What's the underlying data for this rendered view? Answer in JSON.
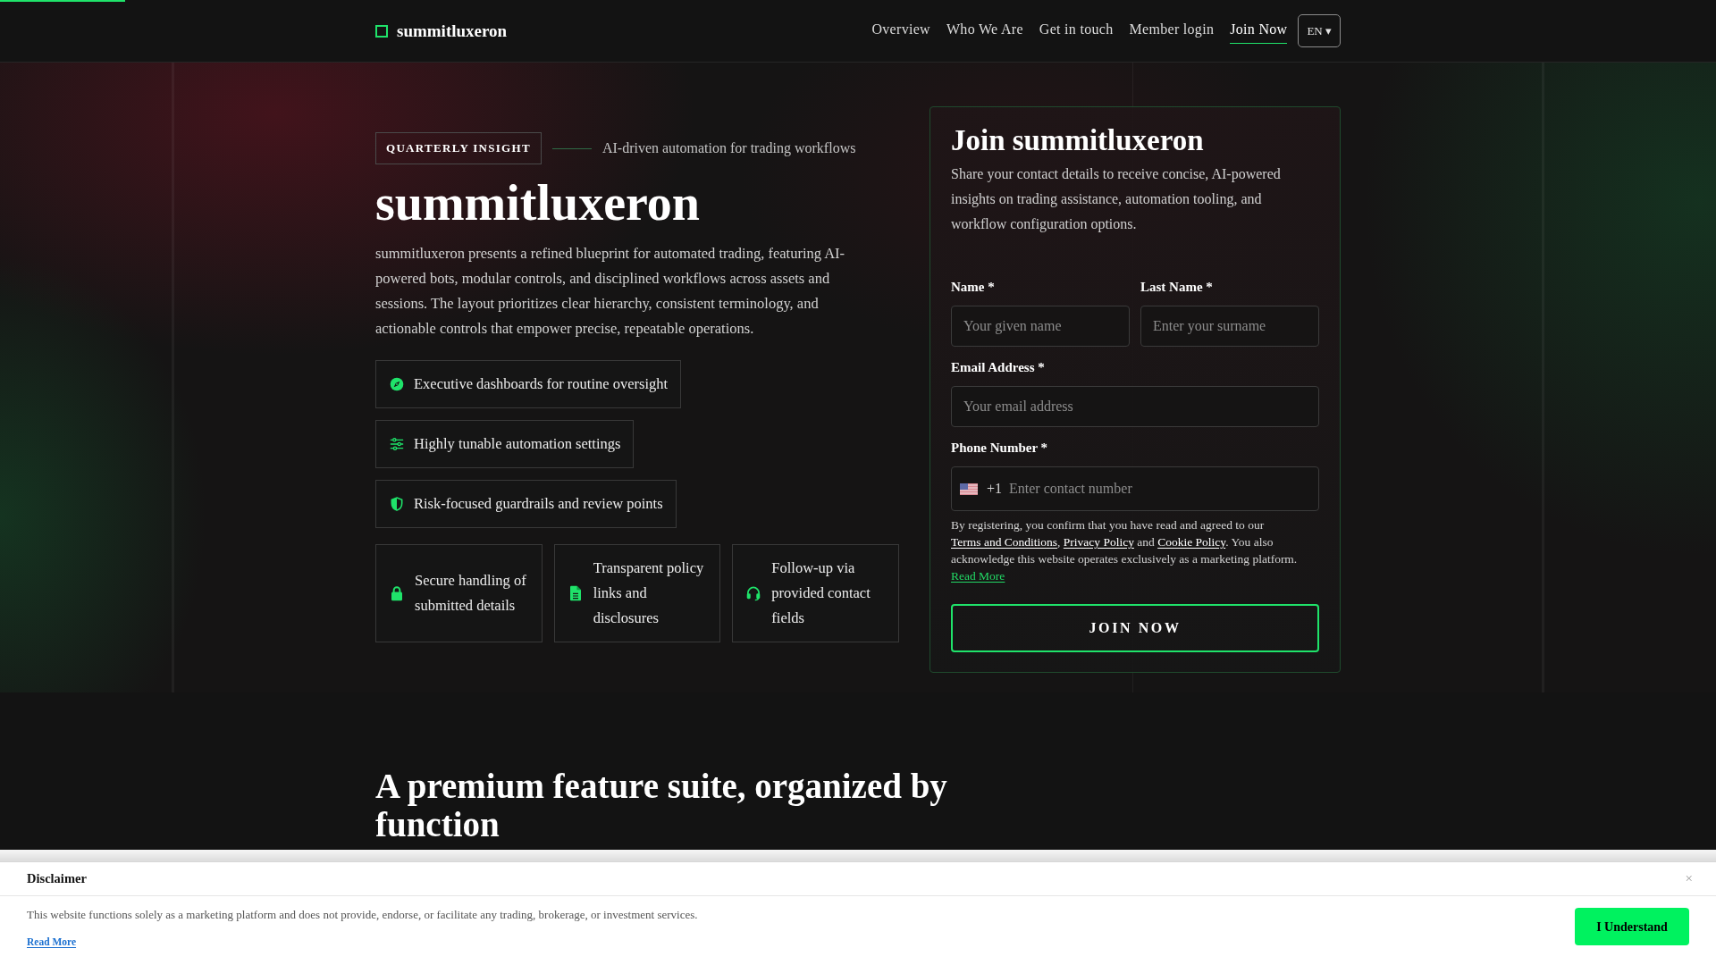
{
  "header": {
    "logo": "summitluxeron",
    "nav": [
      {
        "label": "Overview",
        "selected": false
      },
      {
        "label": "Who We Are",
        "selected": false
      },
      {
        "label": "Get in touch",
        "selected": false
      },
      {
        "label": "Member login",
        "selected": false
      },
      {
        "label": "Join Now",
        "selected": true
      }
    ],
    "language": "EN ▾"
  },
  "hero": {
    "badge": "QUARTERLY INSIGHT",
    "tagline": "AI-driven automation for trading workflows",
    "title": "summitluxeron",
    "description": "summitluxeron presents a refined blueprint for automated trading, featuring AI-powered bots, modular controls, and disciplined workflows across assets and sessions. The layout prioritizes clear hierarchy, consistent terminology, and actionable controls that empower precise, repeatable operations.",
    "highlights": [
      {
        "text": "Executive dashboards for routine oversight"
      },
      {
        "text": "Highly tunable automation settings"
      },
      {
        "text": "Risk-focused guardrails and review points"
      }
    ],
    "cards": [
      {
        "text": "Secure handling of submitted details"
      },
      {
        "text": "Transparent policy links and disclosures"
      },
      {
        "text": "Follow-up via provided contact fields"
      }
    ]
  },
  "signup_form": {
    "title": "Join summitluxeron",
    "description": "Share your contact details to receive concise, AI-powered insights on trading assistance, automation tooling, and workflow configuration options.",
    "rows": [
      [
        {
          "label": "Name *",
          "placeholder": "Your given name",
          "kind": "plain"
        },
        {
          "label": "Last Name *",
          "placeholder": "Enter your surname",
          "kind": "plain"
        }
      ],
      [
        {
          "label": "Email Address *",
          "placeholder": "Your email address",
          "kind": "plain"
        }
      ],
      [
        {
          "label": "Phone Number *",
          "placeholder": "Enter contact number",
          "kind": "phone",
          "prefix": "+1"
        }
      ]
    ],
    "consent": [
      {
        "text": "By registering, you confirm that you have read and agreed to our ",
        "kind": "text"
      },
      {
        "text": "Terms and Conditions",
        "kind": "link"
      },
      {
        "text": ", ",
        "kind": "text"
      },
      {
        "text": "Privacy Policy",
        "kind": "link"
      },
      {
        "text": " and ",
        "kind": "text"
      },
      {
        "text": "Cookie Policy",
        "kind": "link"
      },
      {
        "text": ". You also acknowledge this website operates exclusively as a marketing platform. ",
        "kind": "text"
      },
      {
        "text": "Read More",
        "kind": "highlight_link"
      }
    ],
    "submit": "JOIN NOW"
  },
  "features_section": {
    "heading": "A premium feature suite, organized by function"
  },
  "disclaimer": {
    "title": "Disclaimer",
    "close": "×",
    "text": "This website functions solely as a marketing platform and does not provide, endorse, or facilitate any trading, brokerage, or investment services.",
    "link": "Read More",
    "button": "I Understand"
  }
}
